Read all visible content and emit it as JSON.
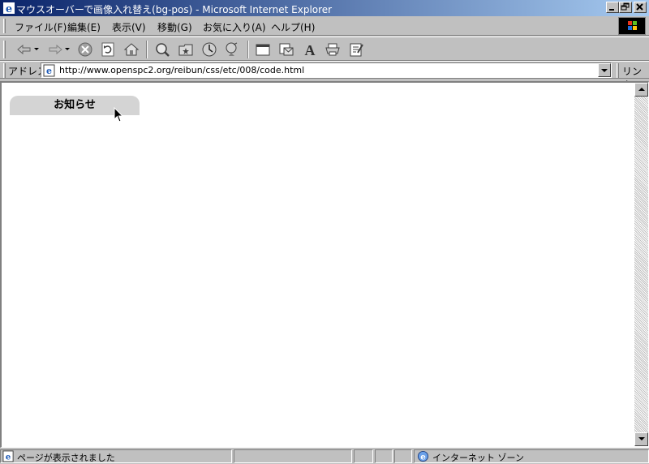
{
  "window": {
    "title": "マウスオーバーで画像入れ替え(bg-pos) - Microsoft Internet Explorer",
    "caption_buttons": [
      "minimize",
      "restore",
      "close"
    ]
  },
  "menu": {
    "items": [
      {
        "label": "ファイル(F)"
      },
      {
        "label": "編集(E)"
      },
      {
        "label": "表示(V)"
      },
      {
        "label": "移動(G)"
      },
      {
        "label": "お気に入り(A)"
      },
      {
        "label": "ヘルプ(H)"
      }
    ]
  },
  "toolbar": {
    "buttons": [
      "back",
      "forward",
      "stop",
      "refresh",
      "home",
      "search",
      "favorites",
      "history",
      "channels",
      "fullscreen",
      "mail",
      "font",
      "print",
      "edit"
    ]
  },
  "address": {
    "label": "アドレス",
    "url": "http://www.openspc2.org/reibun/css/etc/008/code.html",
    "links_label": "リンク"
  },
  "page": {
    "notice_tab": "お知らせ"
  },
  "status": {
    "text": "ページが表示されました",
    "zone": "インターネット ゾーン"
  },
  "colors": {
    "titlebar_start": "#0a246a",
    "titlebar_end": "#a6caf0",
    "chrome": "#c0c0c0",
    "notice_tab_bg": "#d4d4d4"
  }
}
